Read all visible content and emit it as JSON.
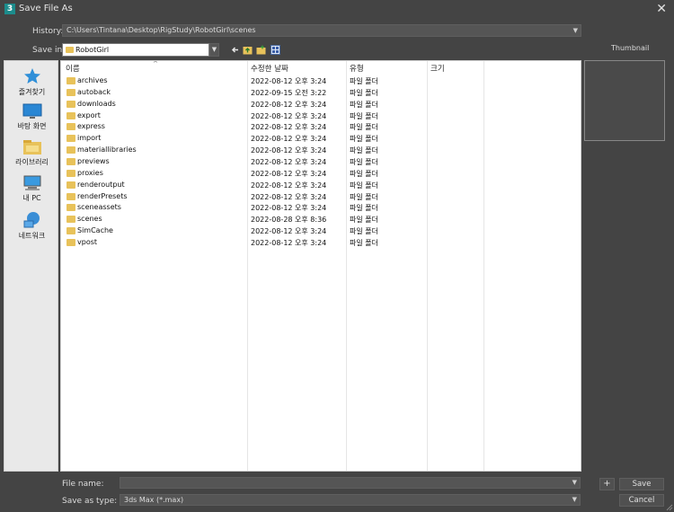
{
  "window": {
    "title": "Save File As",
    "app_badge": "3",
    "close_glyph": "✕"
  },
  "history": {
    "label": "History:",
    "value": "C:\\Users\\Tintana\\Desktop\\RigStudy\\RobotGirl\\scenes"
  },
  "save_in": {
    "label": "Save in:",
    "value": "RobotGirl"
  },
  "toolbar": {
    "icons": [
      "back-arrow-icon",
      "up-folder-icon",
      "new-folder-icon",
      "view-menu-icon"
    ]
  },
  "thumbnail": {
    "label": "Thumbnail"
  },
  "places": [
    {
      "label": "즐겨찾기",
      "icon": "star-icon"
    },
    {
      "label": "바탕 화면",
      "icon": "desktop-icon"
    },
    {
      "label": "라이브러리",
      "icon": "library-icon"
    },
    {
      "label": "내 PC",
      "icon": "computer-icon"
    },
    {
      "label": "네트워크",
      "icon": "network-icon"
    }
  ],
  "columns": {
    "name": "이름",
    "date": "수정한 날짜",
    "type": "유형",
    "size": "크기"
  },
  "files": [
    {
      "name": "archives",
      "date": "2022-08-12 오후 3:24",
      "type": "파일 폴더"
    },
    {
      "name": "autoback",
      "date": "2022-09-15 오전 3:22",
      "type": "파일 폴더"
    },
    {
      "name": "downloads",
      "date": "2022-08-12 오후 3:24",
      "type": "파일 폴더"
    },
    {
      "name": "export",
      "date": "2022-08-12 오후 3:24",
      "type": "파일 폴더"
    },
    {
      "name": "express",
      "date": "2022-08-12 오후 3:24",
      "type": "파일 폴더"
    },
    {
      "name": "import",
      "date": "2022-08-12 오후 3:24",
      "type": "파일 폴더"
    },
    {
      "name": "materiallibraries",
      "date": "2022-08-12 오후 3:24",
      "type": "파일 폴더"
    },
    {
      "name": "previews",
      "date": "2022-08-12 오후 3:24",
      "type": "파일 폴더"
    },
    {
      "name": "proxies",
      "date": "2022-08-12 오후 3:24",
      "type": "파일 폴더"
    },
    {
      "name": "renderoutput",
      "date": "2022-08-12 오후 3:24",
      "type": "파일 폴더"
    },
    {
      "name": "renderPresets",
      "date": "2022-08-12 오후 3:24",
      "type": "파일 폴더"
    },
    {
      "name": "sceneassets",
      "date": "2022-08-12 오후 3:24",
      "type": "파일 폴더"
    },
    {
      "name": "scenes",
      "date": "2022-08-28 오후 8:36",
      "type": "파일 폴더"
    },
    {
      "name": "SimCache",
      "date": "2022-08-12 오후 3:24",
      "type": "파일 폴더"
    },
    {
      "name": "vpost",
      "date": "2022-08-12 오후 3:24",
      "type": "파일 폴더"
    }
  ],
  "file_name": {
    "label": "File name:",
    "value": ""
  },
  "save_as_type": {
    "label": "Save as type:",
    "value": "3ds Max (*.max)"
  },
  "buttons": {
    "plus": "+",
    "save": "Save",
    "cancel": "Cancel"
  },
  "colors": {
    "dialog_bg": "#444444",
    "list_bg": "#ffffff",
    "folder": "#e8c25a",
    "accent": "#1c8c8c"
  }
}
